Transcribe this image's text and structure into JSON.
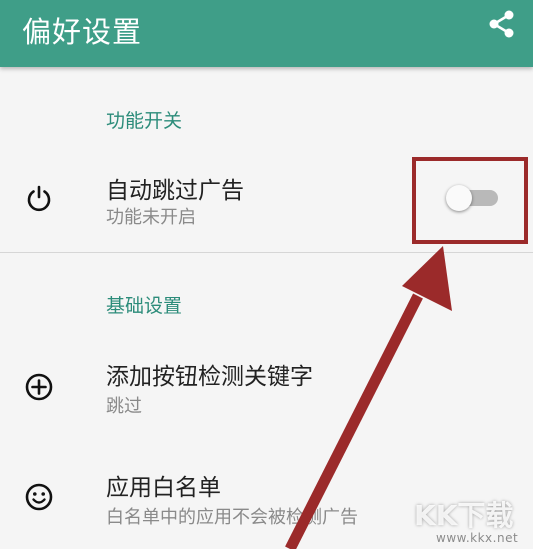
{
  "appbar": {
    "title": "偏好设置",
    "share_icon": "share-icon"
  },
  "sections": {
    "features": {
      "header": "功能开关",
      "auto_skip": {
        "icon": "power-icon",
        "title": "自动跳过广告",
        "summary": "功能未开启",
        "toggle_on": false
      }
    },
    "basic": {
      "header": "基础设置",
      "add_button_keyword": {
        "icon": "add-circle-icon",
        "title": "添加按钮检测关键字",
        "summary": "跳过"
      },
      "whitelist": {
        "icon": "smile-icon",
        "title": "应用白名单",
        "summary": "白名单中的应用不会被检测广告"
      }
    }
  },
  "annotation": {
    "color": "#9b2a2a"
  },
  "watermark": {
    "brand": "KK下载",
    "url": "www.kkx.net"
  },
  "colors": {
    "accent": "#3f9e88",
    "section_header": "#2c8c7a"
  }
}
